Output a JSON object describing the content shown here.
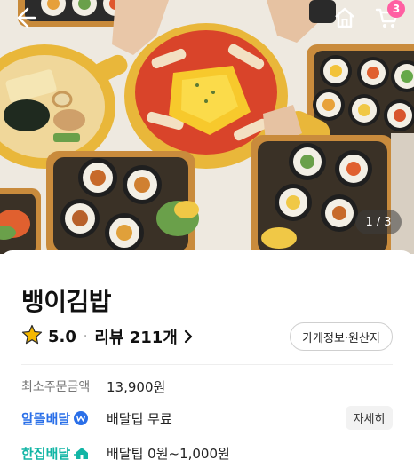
{
  "hero": {
    "page_current": "1",
    "page_separator": "/",
    "page_total": "3",
    "cart_count": "3"
  },
  "store": {
    "name": "뱅이김밥",
    "rating": "5.0",
    "review_text": "리뷰 211개",
    "info_button": "가게정보·원산지"
  },
  "details": {
    "min_order_label": "최소주문금액",
    "min_order_value": "13,900원",
    "thrifty_label": "알뜰배달",
    "thrifty_value": "배달팁 무료",
    "thrifty_detail_button": "자세히",
    "onehouse_label": "한집배달",
    "onehouse_value": "배달팁 0원~1,000원"
  },
  "colors": {
    "badge": "#ff5fa2",
    "thrifty": "#2a6fe8",
    "onehouse": "#12b5a5",
    "star": "#f5b800"
  },
  "icons": {
    "back": "arrow-left-icon",
    "home": "home-icon",
    "cart": "cart-icon",
    "rating": "star-icon",
    "review": "chevron-right-icon",
    "thrifty": "coin-w-icon",
    "onehouse": "house-arrow-icon"
  }
}
